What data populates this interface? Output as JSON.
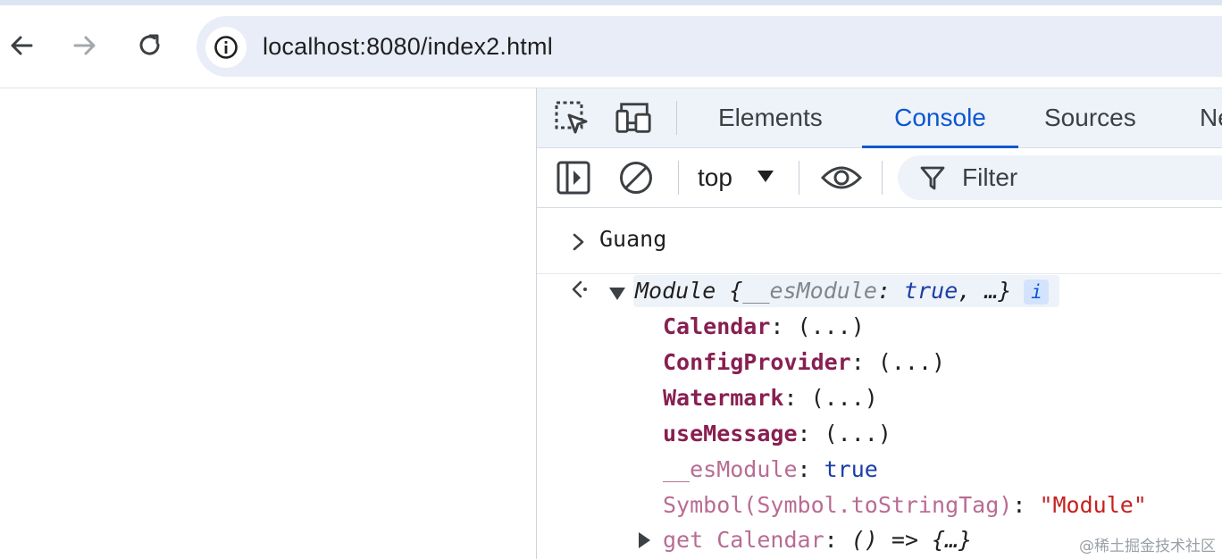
{
  "browser": {
    "url": "localhost:8080/index2.html"
  },
  "devtools": {
    "tabs": [
      {
        "label": "Elements"
      },
      {
        "label": "Console"
      },
      {
        "label": "Sources"
      },
      {
        "label": "Ne"
      }
    ],
    "active_tab": "Console",
    "toolbar": {
      "context": "top",
      "filter_placeholder": "Filter"
    }
  },
  "console": {
    "log_text": "Guang",
    "module": {
      "name": "Module",
      "open_brace": " {",
      "esmodule_key": "__esModule",
      "colon": ": ",
      "esmodule_val": "true",
      "tail": ", …}",
      "info": "i"
    },
    "properties": [
      {
        "key": "Calendar",
        "sep": ": ",
        "value": "(...)"
      },
      {
        "key": "ConfigProvider",
        "sep": ": ",
        "value": "(...)"
      },
      {
        "key": "Watermark",
        "sep": ": ",
        "value": "(...)"
      },
      {
        "key": "useMessage",
        "sep": ": ",
        "value": "(...)"
      },
      {
        "key": "__esModule",
        "sep": ": ",
        "value": "true"
      },
      {
        "key": "Symbol(Symbol.toStringTag)",
        "sep": ": ",
        "value": "\"Module\""
      }
    ],
    "getter": {
      "key": "get Calendar",
      "sep": ": ",
      "value": "() => {…}"
    }
  },
  "watermark": "@稀土掘金技术社区",
  "colors": {
    "accent": "#0b57d0",
    "prop_key": "#881f51",
    "prop_key_dim": "#b86c93",
    "keyword": "#1a3da6",
    "string": "#c5221f"
  }
}
